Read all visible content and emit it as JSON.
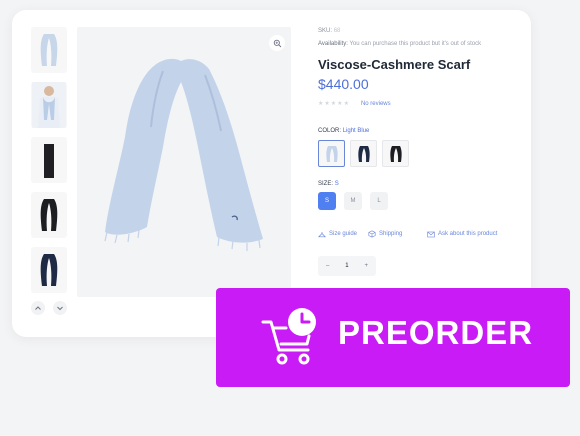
{
  "product": {
    "sku_label": "SKU:",
    "sku_value": "68",
    "availability_label": "Availability:",
    "availability_value": "You can purchase this product but it's out of stock",
    "title": "Viscose-Cashmere Scarf",
    "price": "$440.00",
    "rating": 0,
    "reviews_text": "No reviews",
    "color_label": "COLOR:",
    "color_value": "Light Blue",
    "colors": [
      "Light Blue",
      "Navy",
      "Black"
    ],
    "size_label": "SIZE:",
    "size_value": "S",
    "sizes": [
      "S",
      "M",
      "L"
    ],
    "links": [
      "Size guide",
      "Shipping",
      "Ask about this product"
    ],
    "quantity": "1",
    "qty_minus": "–",
    "qty_plus": "+"
  },
  "gallery": {
    "thumbnails": [
      "light-blue-scarf",
      "model-with-scarf",
      "black-folded-scarf",
      "black-scarf",
      "navy-scarf"
    ]
  },
  "badge": {
    "label": "PREORDER",
    "icon": "cart-clock-icon",
    "color": "#c81bf5"
  },
  "colors": {
    "accent": "#4f6fd8",
    "active_size": "#4f7ff0"
  }
}
